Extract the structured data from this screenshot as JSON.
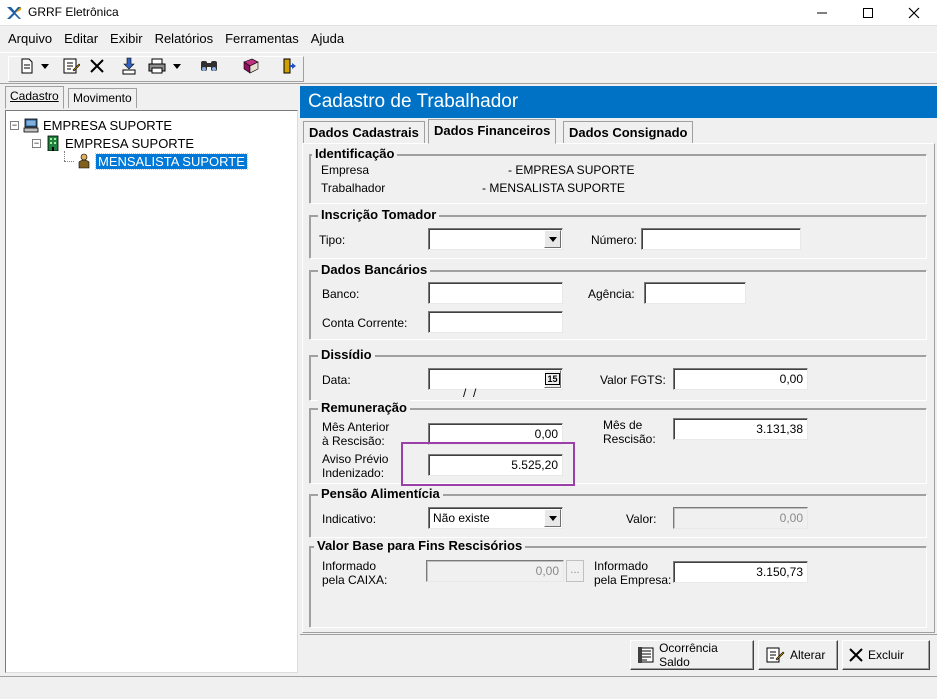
{
  "window": {
    "title": "GRRF Eletrônica"
  },
  "menu": [
    "Arquivo",
    "Editar",
    "Exibir",
    "Relatórios",
    "Ferramentas",
    "Ajuda"
  ],
  "left_tabs": {
    "cadastro": "Cadastro",
    "movimento": "Movimento"
  },
  "tree": {
    "root": "EMPRESA SUPORTE",
    "child": "EMPRESA SUPORTE",
    "leaf": "MENSALISTA SUPORTE"
  },
  "header": {
    "title": "Cadastro de Trabalhador"
  },
  "tabs": [
    "Dados Cadastrais",
    "Dados Financeiros",
    "Dados Consignado"
  ],
  "identificacao": {
    "title": "Identificação",
    "empresa_label": "Empresa",
    "empresa_value": "- EMPRESA SUPORTE",
    "trabalhador_label": "Trabalhador",
    "trabalhador_value": "- MENSALISTA SUPORTE"
  },
  "inscricao": {
    "title": "Inscrição Tomador",
    "tipo_label": "Tipo:",
    "tipo_value": "",
    "numero_label": "Número:",
    "numero_value": ""
  },
  "bancarios": {
    "title": "Dados Bancários",
    "banco_label": "Banco:",
    "banco_value": "",
    "agencia_label": "Agência:",
    "agencia_value": "",
    "conta_label": "Conta Corrente:",
    "conta_value": ""
  },
  "dissidio": {
    "title": "Dissídio",
    "data_label": "Data:",
    "data_value": " /  /",
    "calendar_label": "15",
    "fgts_label": "Valor FGTS:",
    "fgts_value": "0,00"
  },
  "remuneracao": {
    "title": "Remuneração",
    "mes_anterior_label_1": "Mês Anterior",
    "mes_anterior_label_2": "à Rescisão:",
    "mes_anterior_value": "0,00",
    "mes_rescisao_label_1": "Mês de",
    "mes_rescisao_label_2": "Rescisão:",
    "mes_rescisao_value": "3.131,38",
    "aviso_label_1": "Aviso Prévio",
    "aviso_label_2": "Indenizado:",
    "aviso_value": "5.525,20"
  },
  "pensao": {
    "title": "Pensão Alimentícia",
    "indicativo_label": "Indicativo:",
    "indicativo_value": "Não existe",
    "valor_label": "Valor:",
    "valor_value": "0,00"
  },
  "base": {
    "title": "Valor Base para Fins Rescisórios",
    "caixa_label_1": "Informado",
    "caixa_label_2": "pela CAIXA:",
    "caixa_value": "0,00",
    "caixa_btn": "...",
    "empresa_label_1": "Informado",
    "empresa_label_2": "pela Empresa:",
    "empresa_value": "3.150,73"
  },
  "buttons": {
    "ocorrencia": "Ocorrência Saldo",
    "alterar": "Alterar",
    "excluir": "Excluir"
  },
  "colors": {
    "header_bg": "#0072c6",
    "highlight": "#9b3fa9",
    "selection": "#0078d7"
  }
}
